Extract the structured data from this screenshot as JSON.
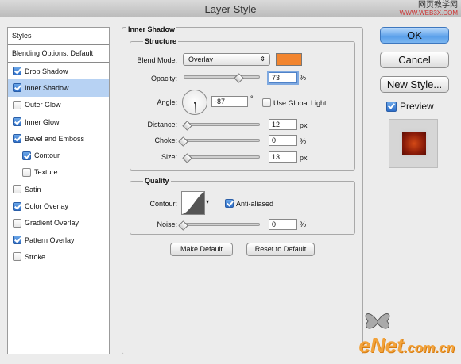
{
  "window": {
    "title": "Layer Style",
    "watermark_top_line1": "网页教学网",
    "watermark_top_line2": "WWW.WEB3X.COM"
  },
  "styles_list": {
    "header": "Styles",
    "blending": "Blending Options: Default",
    "items": [
      {
        "label": "Drop Shadow",
        "checked": true
      },
      {
        "label": "Inner Shadow",
        "checked": true,
        "selected": true
      },
      {
        "label": "Outer Glow",
        "checked": false
      },
      {
        "label": "Inner Glow",
        "checked": true
      },
      {
        "label": "Bevel and Emboss",
        "checked": true
      },
      {
        "label": "Contour",
        "checked": true,
        "indent": true
      },
      {
        "label": "Texture",
        "checked": false,
        "indent": true
      },
      {
        "label": "Satin",
        "checked": false
      },
      {
        "label": "Color Overlay",
        "checked": true
      },
      {
        "label": "Gradient Overlay",
        "checked": false
      },
      {
        "label": "Pattern Overlay",
        "checked": true
      },
      {
        "label": "Stroke",
        "checked": false
      }
    ]
  },
  "inner_shadow": {
    "section_title": "Inner Shadow",
    "structure": {
      "title": "Structure",
      "blend_mode_label": "Blend Mode:",
      "blend_mode_value": "Overlay",
      "blend_color": "#f2852f",
      "opacity_label": "Opacity:",
      "opacity_value": "73",
      "opacity_unit": "%",
      "opacity_level": 0.73,
      "angle_label": "Angle:",
      "angle_value": "-87",
      "angle_unit": "°",
      "use_global_light_label": "Use Global Light",
      "use_global_light_checked": false,
      "distance_label": "Distance:",
      "distance_value": "12",
      "distance_unit": "px",
      "distance_level": 0.05,
      "choke_label": "Choke:",
      "choke_value": "0",
      "choke_unit": "%",
      "choke_level": 0.0,
      "size_label": "Size:",
      "size_value": "13",
      "size_unit": "px",
      "size_level": 0.05
    },
    "quality": {
      "title": "Quality",
      "contour_label": "Contour:",
      "anti_aliased_label": "Anti-aliased",
      "anti_aliased_checked": true,
      "noise_label": "Noise:",
      "noise_value": "0",
      "noise_unit": "%",
      "noise_level": 0.0
    },
    "make_default": "Make Default",
    "reset_default": "Reset to Default"
  },
  "buttons": {
    "ok": "OK",
    "cancel": "Cancel",
    "new_style": "New Style...",
    "preview_label": "Preview",
    "preview_checked": true
  },
  "branding": {
    "enet_main": "eNet",
    "enet_suffix": ".com.cn"
  },
  "colors": {
    "selection": "#b7d2f3",
    "accent_blue": "#5aa0ea",
    "blend_swatch": "#f2852f"
  }
}
